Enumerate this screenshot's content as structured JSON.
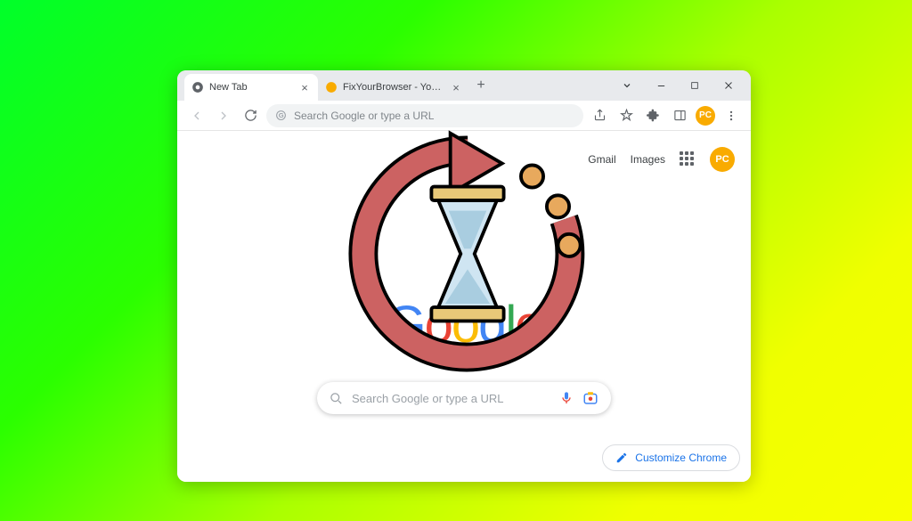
{
  "tabs": [
    {
      "label": "New Tab",
      "active": true
    },
    {
      "label": "FixYourBrowser - Your Trusted S…",
      "active": false
    }
  ],
  "omnibox": {
    "placeholder": "Search Google or type a URL"
  },
  "profile": {
    "initials": "PC"
  },
  "topRight": {
    "gmail": "Gmail",
    "images": "Images"
  },
  "logo": {
    "letters": [
      "G",
      "o",
      "o",
      "g",
      "l",
      "e"
    ]
  },
  "searchbox": {
    "placeholder": "Search Google or type a URL"
  },
  "customize": {
    "label": "Customize Chrome"
  }
}
